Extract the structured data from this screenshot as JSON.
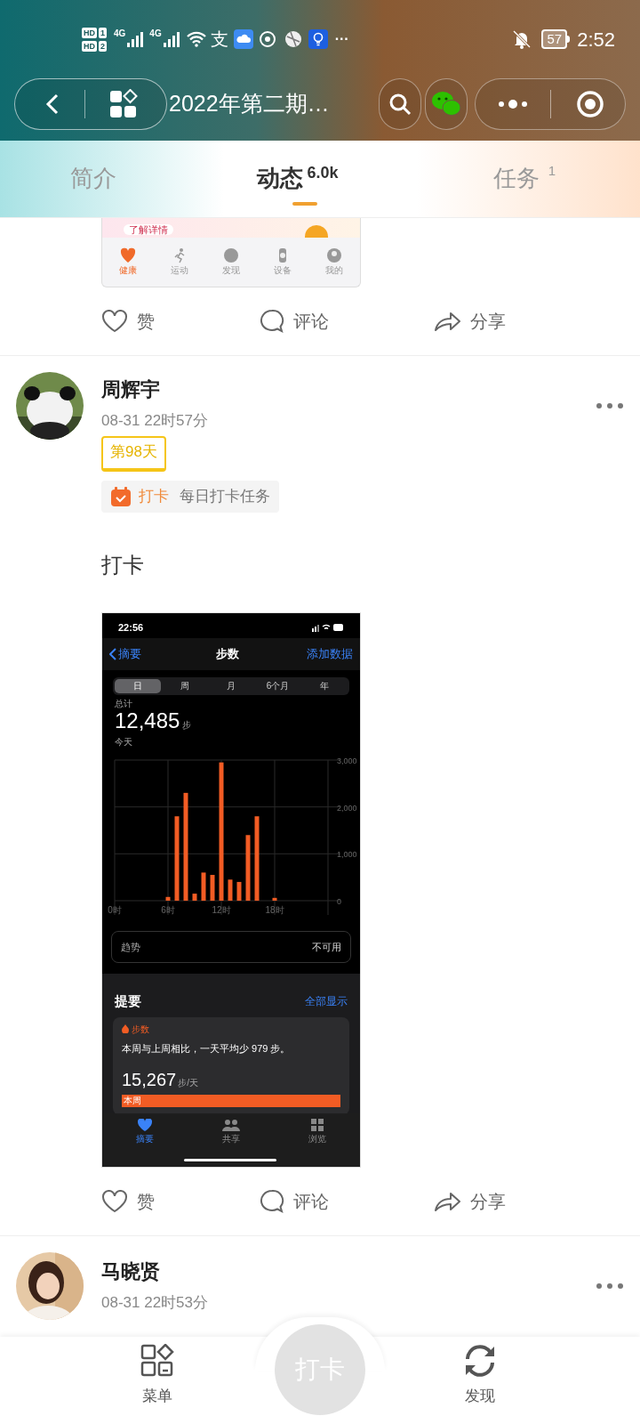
{
  "status_bar": {
    "sims": [
      {
        "badge": "HD",
        "slot": "1"
      },
      {
        "badge": "HD",
        "slot": "2"
      }
    ],
    "network_labels": [
      "4G",
      "4G"
    ],
    "pay_glyph": "支",
    "overflow": "···",
    "battery": "57",
    "time": "2:52"
  },
  "nav": {
    "title": "2022年第二期…"
  },
  "tabs": [
    {
      "label": "简介",
      "selected": false
    },
    {
      "label": "动态",
      "count": "6.0k",
      "selected": true
    },
    {
      "label": "任务",
      "count": "1",
      "selected": false
    }
  ],
  "posts": [
    {
      "kind": "partial",
      "app_image": {
        "link": "了解详情",
        "tabs": [
          {
            "label": "健康",
            "selected": true
          },
          {
            "label": "运动",
            "selected": false
          },
          {
            "label": "发现",
            "selected": false
          },
          {
            "label": "设备",
            "selected": false
          },
          {
            "label": "我的",
            "selected": false
          }
        ]
      },
      "actions": [
        "赞",
        "评论",
        "分享"
      ]
    },
    {
      "kind": "full",
      "author": "周辉宇",
      "time": "08-31 22时57分",
      "day_badge": "第98天",
      "task": {
        "tag": "打卡",
        "name": "每日打卡任务"
      },
      "text": "打卡",
      "screenshot": {
        "clock": "22:56",
        "back": "摘要",
        "title": "步数",
        "action": "添加数据",
        "segments": [
          {
            "label": "日",
            "selected": true
          },
          {
            "label": "周",
            "selected": false
          },
          {
            "label": "月",
            "selected": false
          },
          {
            "label": "6个月",
            "selected": false
          },
          {
            "label": "年",
            "selected": false
          }
        ],
        "total_label": "总计",
        "total": "12,485",
        "unit": "步",
        "period": "今天",
        "chart_data": {
          "type": "bar",
          "x": [
            6,
            7,
            8,
            9,
            10,
            11,
            12,
            13,
            14,
            15,
            16,
            18
          ],
          "values": [
            80,
            1800,
            2300,
            150,
            600,
            550,
            2950,
            450,
            400,
            1400,
            1800,
            60
          ],
          "xlim": [
            0,
            24
          ],
          "ylim": [
            0,
            3000
          ],
          "grid": true,
          "xticks": [
            {
              "value": 0,
              "label": "0时"
            },
            {
              "value": 6,
              "label": "6时"
            },
            {
              "value": 12,
              "label": "12时"
            },
            {
              "value": 18,
              "label": "18时"
            }
          ],
          "yticks": [
            {
              "value": 0,
              "label": "0"
            },
            {
              "value": 1000,
              "label": "1,000"
            },
            {
              "value": 2000,
              "label": "2,000"
            },
            {
              "value": 3000,
              "label": "3,000"
            }
          ]
        },
        "trend_label": "趋势",
        "trend_value": "不可用",
        "highlights_title": "提要",
        "show_all": "全部显示",
        "highlight": {
          "tag": "步数",
          "sentence": "本周与上周相比，一天平均少 979 步。",
          "value": "15,267",
          "unit": "步/天",
          "bar_label": "本周"
        },
        "tabs": [
          {
            "label": "摘要",
            "selected": true
          },
          {
            "label": "共享",
            "selected": false
          },
          {
            "label": "浏览",
            "selected": false
          }
        ]
      },
      "actions": [
        "赞",
        "评论",
        "分享"
      ]
    },
    {
      "kind": "cut",
      "author": "马晓贤",
      "time": "08-31 22时53分"
    }
  ],
  "bottom_bar": {
    "menu": "菜单",
    "checkin": "打卡",
    "discover": "发现"
  }
}
